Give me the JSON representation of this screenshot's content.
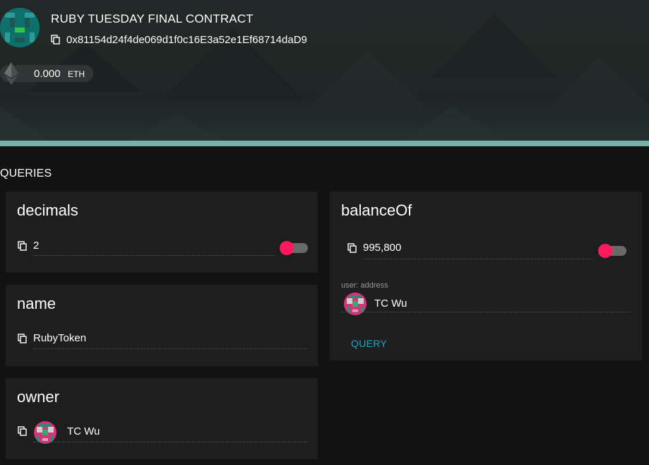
{
  "contract": {
    "name": "RUBY TUESDAY FINAL CONTRACT",
    "address": "0x81154d24f4de069d1f0c16E3a52e1Ef68714daD9",
    "balance": "0.000",
    "unit": "ETH"
  },
  "queries_heading": "QUERIES",
  "cards": {
    "decimals": {
      "title": "decimals",
      "value": "2"
    },
    "name": {
      "title": "name",
      "value": "RubyToken"
    },
    "owner": {
      "title": "owner",
      "value": "TC Wu"
    },
    "balanceOf": {
      "title": "balanceOf",
      "value": "995,800",
      "input_label": "user: address",
      "input_value": "TC Wu",
      "query_label": "QUERY"
    }
  },
  "colors": {
    "accent_pink": "#ff1a5e",
    "link_blue": "#25a3c2",
    "header_stripe": "#78b0aa",
    "card_bg": "#1e1e1e",
    "page_bg": "#121212"
  },
  "icons": {
    "copy": "copy-icon",
    "eth": "ethereum-icon",
    "avatar": "identicon-avatar"
  }
}
